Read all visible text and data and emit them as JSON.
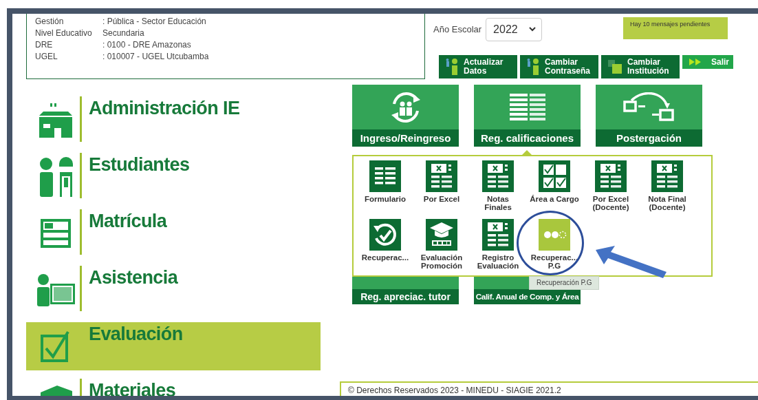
{
  "info": [
    {
      "label": "Gestión",
      "value": ": Pública - Sector Educación"
    },
    {
      "label": "Nivel Educativo",
      "value": "Secundaria"
    },
    {
      "label": "DRE",
      "value": ": 0100 - DRE Amazonas"
    },
    {
      "label": "UGEL",
      "value": ": 010007 - UGEL Utcubamba"
    }
  ],
  "school_year": {
    "label": "Año Escolar",
    "value": "2022"
  },
  "messages": "Hay 10 mensajes pendientes",
  "header_buttons": [
    {
      "kind": "person",
      "lines": [
        "Actualizar",
        "Datos"
      ]
    },
    {
      "kind": "person",
      "lines": [
        "Cambiar",
        "Contraseña"
      ]
    },
    {
      "kind": "squares",
      "lines": [
        "Cambiar",
        "Institución"
      ]
    },
    {
      "kind": "arrows",
      "lines": [
        "Salir"
      ]
    }
  ],
  "sidebar": [
    {
      "kind": "building",
      "label": "Administración IE",
      "selected": false
    },
    {
      "kind": "students",
      "label": "Estudiantes",
      "selected": false
    },
    {
      "kind": "form",
      "label": "Matrícula",
      "selected": false
    },
    {
      "kind": "attendance",
      "label": "Asistencia",
      "selected": false
    },
    {
      "kind": "checkbox",
      "label": "Evaluación",
      "selected": true
    },
    {
      "kind": "materials",
      "label": "Materiales",
      "selected": false
    }
  ],
  "tiles": [
    {
      "kind": "cycle",
      "label": "Ingreso/Reingreso",
      "expanded": false
    },
    {
      "kind": "table",
      "label": "Reg. calificaciones",
      "expanded": true
    },
    {
      "kind": "transfer",
      "label": "Postergación",
      "expanded": false
    }
  ],
  "submenu": [
    {
      "kind": "grid",
      "label": "Formulario",
      "selected": false
    },
    {
      "kind": "excel",
      "label": "Por Excel",
      "selected": false
    },
    {
      "kind": "excel",
      "label": "Notas\nFinales",
      "selected": false
    },
    {
      "kind": "checks",
      "label": "Área a Cargo",
      "selected": false
    },
    {
      "kind": "excel",
      "label": "Por Excel\n(Docente)",
      "selected": false
    },
    {
      "kind": "excel",
      "label": "Nota Final\n(Docente)",
      "selected": false
    },
    {
      "kind": "refresh",
      "label": "Recuperac...",
      "selected": false
    },
    {
      "kind": "cap",
      "label": "Evaluación\nPromoción",
      "selected": false
    },
    {
      "kind": "excel",
      "label": "Registro\nEvaluación",
      "selected": false
    },
    {
      "kind": "dots",
      "label": "Recuperac...\nP.G",
      "selected": true
    }
  ],
  "tooltip": "Recuperación P.G",
  "lower_tiles": [
    {
      "label": "Reg. apreciac. tutor"
    },
    {
      "label": "Calif. Anual de Comp. y Área"
    }
  ],
  "footer": "© Derechos Reservados 2023 - MINEDU - SIAGIE 2021.2"
}
